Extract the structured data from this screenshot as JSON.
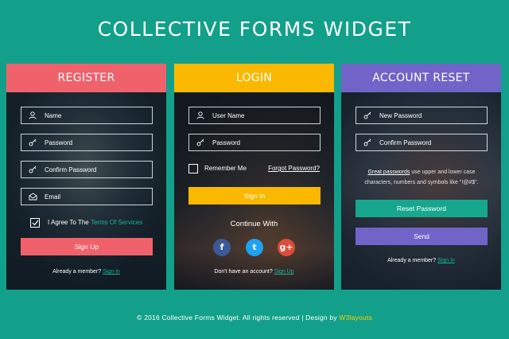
{
  "page_title": "COLLECTIVE FORMS WIDGET",
  "register": {
    "heading": "REGISTER",
    "name_placeholder": "Name",
    "password_placeholder": "Password",
    "confirm_placeholder": "Confirm Password",
    "email_placeholder": "Email",
    "agree_prefix": "I Agree To The",
    "terms_link": "Terms Of Services",
    "submit_label": "Sign Up",
    "member_text": "Already a member?",
    "sign_in_link": "Sign In"
  },
  "login": {
    "heading": "LOGIN",
    "username_placeholder": "User Name",
    "password_placeholder": "Password",
    "remember_label": "Remember Me",
    "forgot_link": "Forgot Password?",
    "submit_label": "Sign In",
    "continue_label": "Continue With",
    "social": [
      {
        "icon": "facebook-icon",
        "glyph": "f",
        "color": "#3b5998"
      },
      {
        "icon": "twitter-icon",
        "glyph": "t",
        "color": "#1da1f2"
      },
      {
        "icon": "google-plus-icon",
        "glyph": "g+",
        "color": "#dd4b39"
      }
    ],
    "no_account_text": "Don't have an account?",
    "sign_up_link": "Sign Up"
  },
  "reset": {
    "heading": "ACCOUNT RESET",
    "new_password_placeholder": "New Password",
    "confirm_password_placeholder": "Confirm Password",
    "hint_link": "Great passwords",
    "hint_rest": "use upper and lower case characters, numbers and symbols like \"!@#$\".",
    "reset_button": "Reset Password",
    "send_button": "Send",
    "member_text": "Already a member?",
    "sign_in_link": "Sign In"
  },
  "footer": {
    "text": "© 2016 Collective Forms Widget. All rights reserved | Design by",
    "brand": "W3layouts"
  },
  "colors": {
    "background": "#12a08a",
    "register_accent": "#f0626b",
    "login_accent": "#fbb800",
    "reset_accent": "#7064c8",
    "reset_button": "#17a78e",
    "link": "#17b39a"
  }
}
